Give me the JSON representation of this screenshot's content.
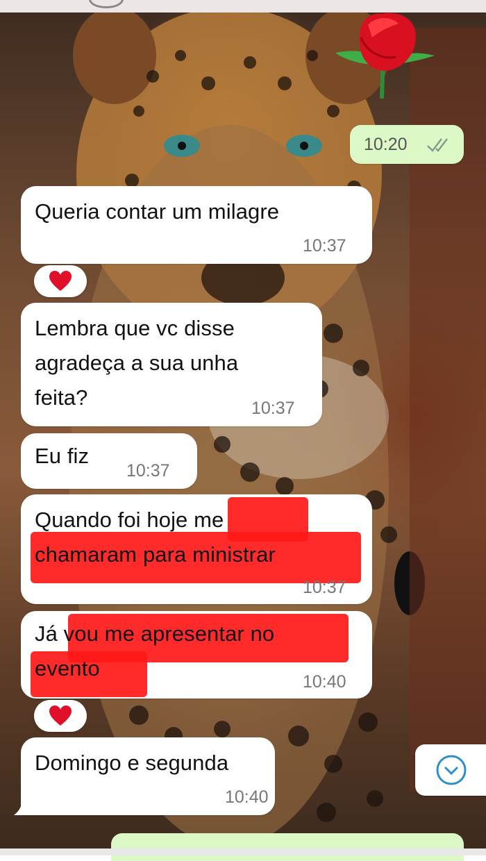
{
  "chat": {
    "outgoing": {
      "time": "10:20",
      "status_icon": "double-check-icon"
    },
    "messages": [
      {
        "text": "Queria contar um milagre",
        "time": "10:37"
      },
      {
        "line1": "Lembra que vc disse",
        "line2": "agradeça a sua unha",
        "line3": "feita?",
        "time": "10:37"
      },
      {
        "text": "Eu fiz",
        "time": "10:37"
      },
      {
        "line1a": "Quando foi hoje",
        "line1b": "me",
        "line2": "chamaram para ministrar",
        "time": "10:37",
        "redacted": true
      },
      {
        "line1a": "Já",
        "line1b": "vou me apresentar no",
        "line2": "evento",
        "time": "10:40",
        "redacted": true
      },
      {
        "text": "Domingo e segunda",
        "time": "10:40"
      }
    ],
    "reactions": [
      {
        "emoji": "heart-icon",
        "color": "#e0102b"
      },
      {
        "emoji": "heart-icon",
        "color": "#e0102b"
      }
    ],
    "scroll_down_icon": "chevron-down-circle-icon",
    "colors": {
      "incoming_bubble": "#ffffff",
      "outgoing_bubble": "#dcf8c6",
      "redaction": "#ff1818",
      "accent": "#2b8fc9"
    }
  }
}
